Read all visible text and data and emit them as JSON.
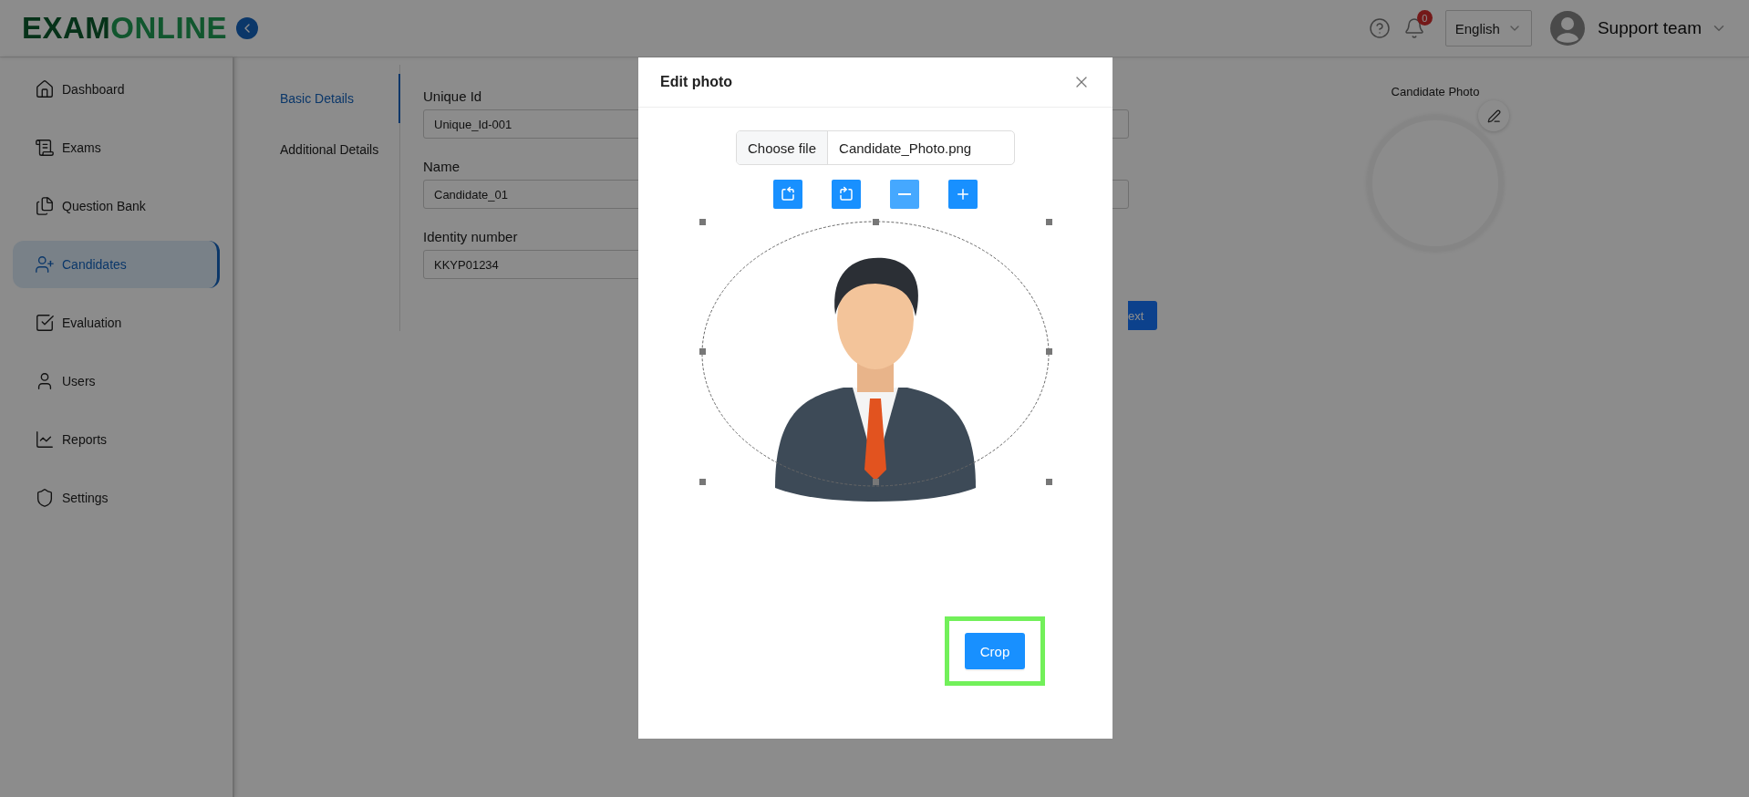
{
  "header": {
    "logo": {
      "part_1": "EXAM",
      "part_2": "ONLINE"
    },
    "notifications": {
      "count": "0"
    },
    "language": "English",
    "user": "Support team"
  },
  "sidebar": {
    "items": [
      {
        "label": "Dashboard",
        "selected": false
      },
      {
        "label": "Exams",
        "selected": false
      },
      {
        "label": "Question Bank",
        "selected": false
      },
      {
        "label": "Candidates",
        "selected": true
      },
      {
        "label": "Evaluation",
        "selected": false
      },
      {
        "label": "Users",
        "selected": false
      },
      {
        "label": "Reports",
        "selected": false
      },
      {
        "label": "Settings",
        "selected": false
      }
    ]
  },
  "form": {
    "tabs": [
      {
        "label": "Basic Details",
        "selected": true
      },
      {
        "label": "Additional Details",
        "selected": false
      }
    ],
    "fields": [
      {
        "label": "Unique Id",
        "value": "Unique_Id-001"
      },
      {
        "label": "Name",
        "value": "Candidate_01"
      },
      {
        "label": "Identity number",
        "value": "KKYP01234"
      }
    ],
    "next_button": "ext"
  },
  "photo": {
    "label": "Candidate Photo"
  },
  "modal": {
    "title": "Edit photo",
    "file": {
      "button": "Choose file",
      "name": "Candidate_Photo.png"
    },
    "tools": [
      {
        "kind": "rotate-left",
        "highlighted": false
      },
      {
        "kind": "rotate-right",
        "highlighted": false
      },
      {
        "kind": "zoom-out",
        "highlighted": true
      },
      {
        "kind": "zoom-in",
        "highlighted": false
      }
    ],
    "crop_button": "Crop"
  }
}
